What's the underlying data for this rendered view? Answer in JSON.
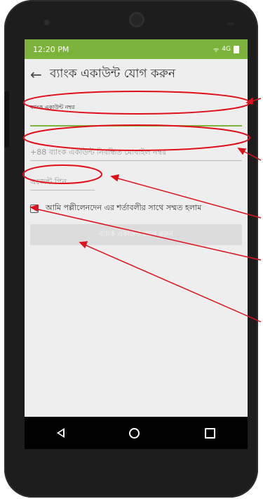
{
  "status_bar": {
    "time": "12:20 PM",
    "network": "4G",
    "signal": "ᯤ"
  },
  "app_bar": {
    "title": "ব্যাংক একাউন্ট যোগ করুন",
    "back_icon": "arrow-left-icon"
  },
  "form": {
    "account_number_label": "ব্যাংক একাউন্ট নম্বর",
    "mobile_placeholder": "+88 ব্যাংক একাউন্ট নিবন্ধিত মোবাইল নম্বর",
    "pin_placeholder": "এজেন্ট পিন",
    "terms_text": "আমি পল্লীলেনদেন এর শর্তাবলীর সাথে সম্মত হলাম",
    "terms_checked": false,
    "submit_label": "ব্যাংক একাউন্ট যোগ করুন"
  },
  "nav_bar": {
    "back": "triangle-back-icon",
    "home": "circle-home-icon",
    "recent": "square-recent-icon"
  },
  "colors": {
    "accent": "#7bb33b",
    "annotation": "#e0101a"
  }
}
